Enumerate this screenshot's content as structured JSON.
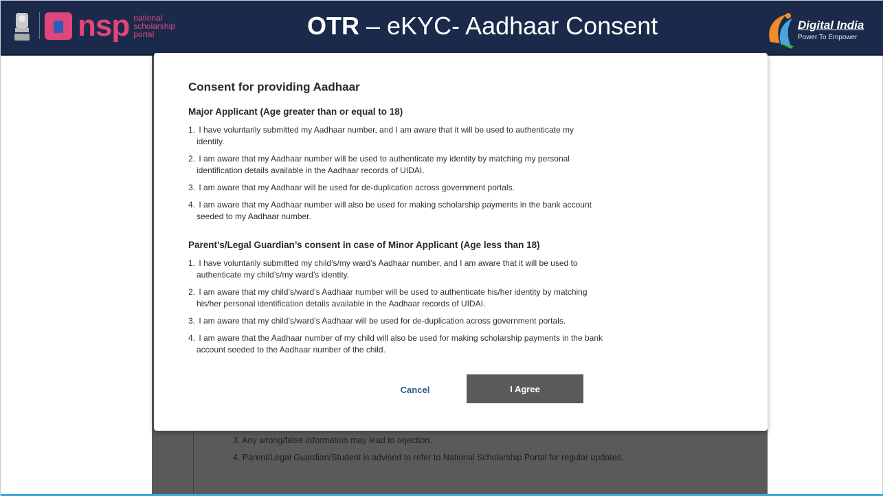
{
  "header": {
    "title_bold": "OTR",
    "title_rest": " – eKYC- Aadhaar Consent",
    "nsp_short": "nsp",
    "nsp_sub_1": "national",
    "nsp_sub_2": "scholarship",
    "nsp_sub_3": "portal",
    "di_name": "Digital India",
    "di_tag": "Power To Empower"
  },
  "modal": {
    "title": "Consent for providing Aadhaar",
    "major": {
      "heading": "Major Applicant (Age greater than or equal to 18)",
      "items": [
        {
          "num": "1.",
          "line1": "I have voluntarily submitted my Aadhaar number, and I am aware that it will be used to authenticate my",
          "line2": "identity."
        },
        {
          "num": "2.",
          "line1": "I am aware that my Aadhaar number will be used to authenticate my identity by matching my personal",
          "line2": "identification details available in the Aadhaar records of UIDAI."
        },
        {
          "num": "3.",
          "line1": "I am aware that my Aadhaar will be used for de-duplication across government portals.",
          "line2": ""
        },
        {
          "num": "4.",
          "line1": "I am aware that my Aadhaar number will also be used for making scholarship payments in the bank account",
          "line2": "seeded to my Aadhaar number."
        }
      ]
    },
    "minor": {
      "heading": "Parent’s/Legal Guardian’s consent in case of Minor Applicant (Age less than 18)",
      "items": [
        {
          "num": "1.",
          "line1": "I have voluntarily submitted my child’s/my ward’s Aadhaar number, and I am aware that it will be used to",
          "line2": "authenticate my child’s/my ward’s identity."
        },
        {
          "num": "2.",
          "line1": "I am aware that my child’s/ward’s Aadhaar number will be used to authenticate his/her identity by matching",
          "line2": "his/her personal identification details available in the Aadhaar records of UIDAI."
        },
        {
          "num": "3.",
          "line1": "I am aware that my child’s/ward’s Aadhaar will be used for de-duplication across government portals.",
          "line2": ""
        },
        {
          "num": "4.",
          "line1": "I am aware that the Aadhaar number of my child will also be used for making scholarship payments in the bank",
          "line2": "account seeded to the Aadhaar number of the child."
        }
      ]
    },
    "cancel_label": "Cancel",
    "agree_label": "I Agree"
  },
  "background": {
    "note_3": "3. Any wrong/false information may lead to rejection.",
    "note_4": "4. Parent/Legal Guardian/Student is advised to refer to National Scholarship Portal for regular updates."
  },
  "colors": {
    "header_bg": "#1b2a4a",
    "nsp_pink": "#e0457b",
    "agree_button": "#5a5a5a",
    "cancel_text": "#2e5b8a"
  },
  "icons": {
    "emblem": "national-emblem-icon",
    "nsp": "nsp-logo-icon",
    "digital_india": "digital-india-logo-icon"
  }
}
